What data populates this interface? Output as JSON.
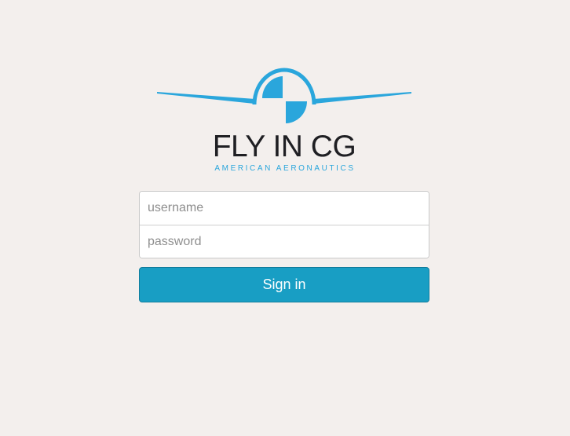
{
  "brand": {
    "name": "FLY IN CG",
    "tagline": "AMERICAN AERONAUTICS",
    "logo_icon": "airplane-propeller-logo"
  },
  "login": {
    "username_placeholder": "username",
    "username_value": "",
    "password_placeholder": "password",
    "password_value": "",
    "submit_label": "Sign in"
  },
  "colors": {
    "background": "#f3efed",
    "brand_blue": "#2aa6dc",
    "button": "#189ec4",
    "text_dark": "#1f1f23"
  }
}
